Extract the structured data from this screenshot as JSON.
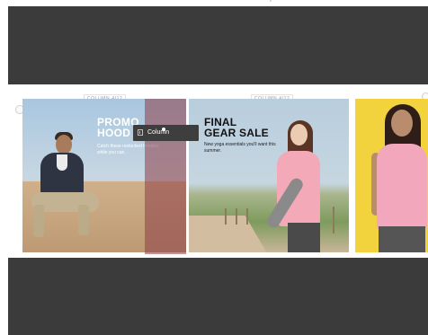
{
  "column_tags": [
    "COLUMN 4/12",
    "COLUMN 4/12"
  ],
  "promo": {
    "title_line1": "PROMO",
    "title_line2": "HOOD",
    "body": "Catch these restocked hoodies while you can."
  },
  "final": {
    "title_line1": "FINAL",
    "title_line2": "GEAR SALE",
    "body": "New yoga essentials you'll want this summer."
  },
  "tooltip": {
    "label": "Column",
    "icon": "column-icon"
  },
  "colors": {
    "editor_dark": "#3b3b3b",
    "highlight": "#8c3c46",
    "panel3_bg": "#f2d33e"
  }
}
